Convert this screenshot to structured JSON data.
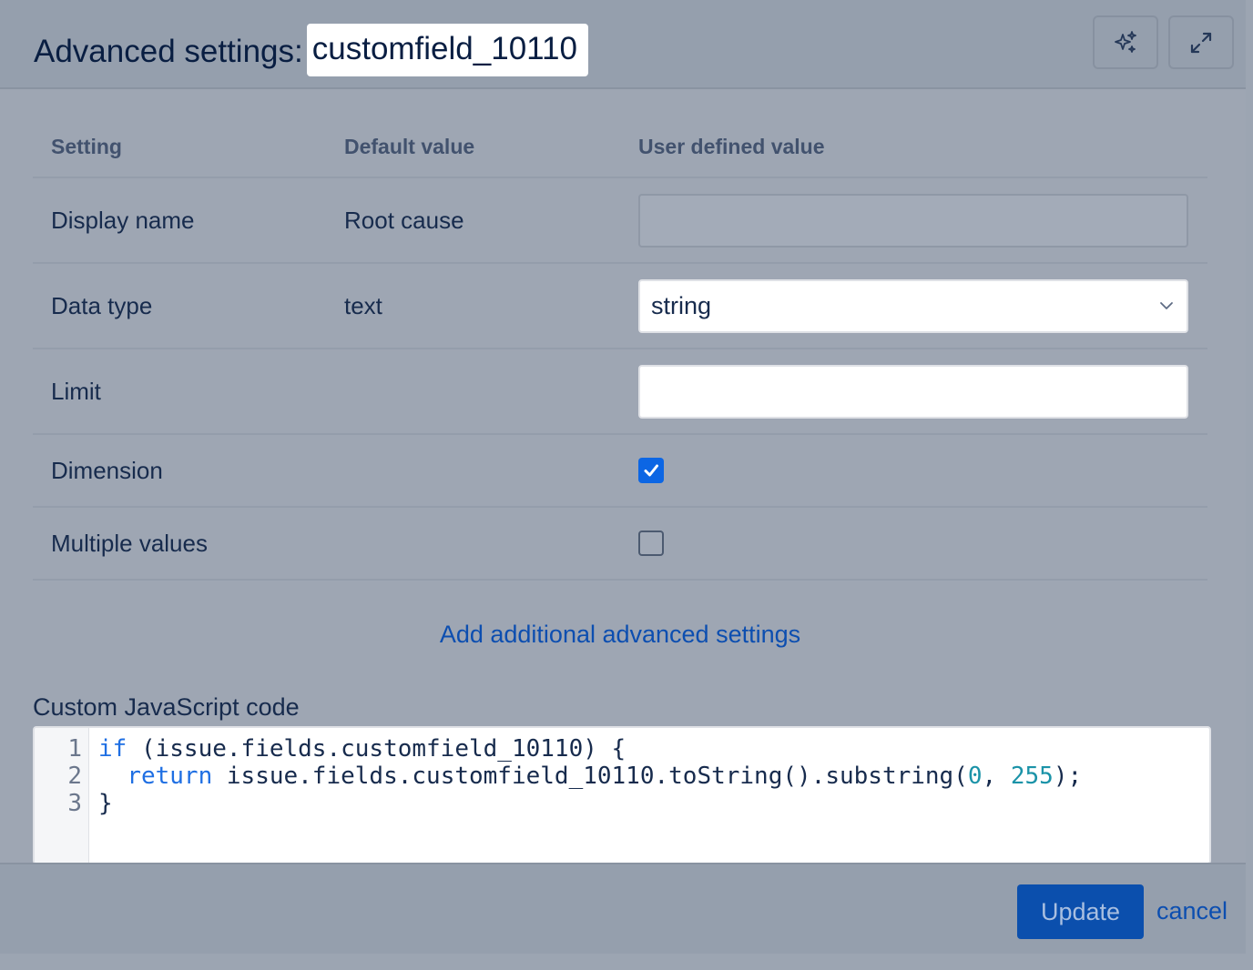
{
  "header": {
    "title": "Advanced settings:",
    "field_key": "customfield_10110",
    "ai_icon": "sparkles-icon",
    "expand_icon": "expand-icon"
  },
  "table": {
    "columns": [
      "Setting",
      "Default value",
      "User defined value"
    ],
    "rows": [
      {
        "setting": "Display name",
        "default": "Root cause",
        "control": "text-input",
        "value": ""
      },
      {
        "setting": "Data type",
        "default": "text",
        "control": "select",
        "value": "string"
      },
      {
        "setting": "Limit",
        "default": "",
        "control": "text-input",
        "value": ""
      },
      {
        "setting": "Dimension",
        "default": "",
        "control": "checkbox",
        "checked": true
      },
      {
        "setting": "Multiple values",
        "default": "",
        "control": "checkbox",
        "checked": false
      }
    ]
  },
  "add_link": "Add additional advanced settings",
  "code": {
    "label": "Custom JavaScript code",
    "line_numbers": [
      "1",
      "2",
      "3"
    ],
    "lines": [
      {
        "kw": "if",
        "rest": " (issue.fields.customfield_10110) {"
      },
      {
        "indent": "  ",
        "kw": "return",
        "rest": " issue.fields.customfield_10110.toString().substring(",
        "n1": "0",
        "sep": ", ",
        "n2": "255",
        "end": ");"
      },
      {
        "rest": "}"
      }
    ]
  },
  "footer": {
    "update_label": "Update",
    "cancel_label": "cancel"
  },
  "colors": {
    "primary": "#0c66e4",
    "link": "#0c4eb0",
    "keyword": "#1f6fe3",
    "number": "#1b93a8"
  }
}
